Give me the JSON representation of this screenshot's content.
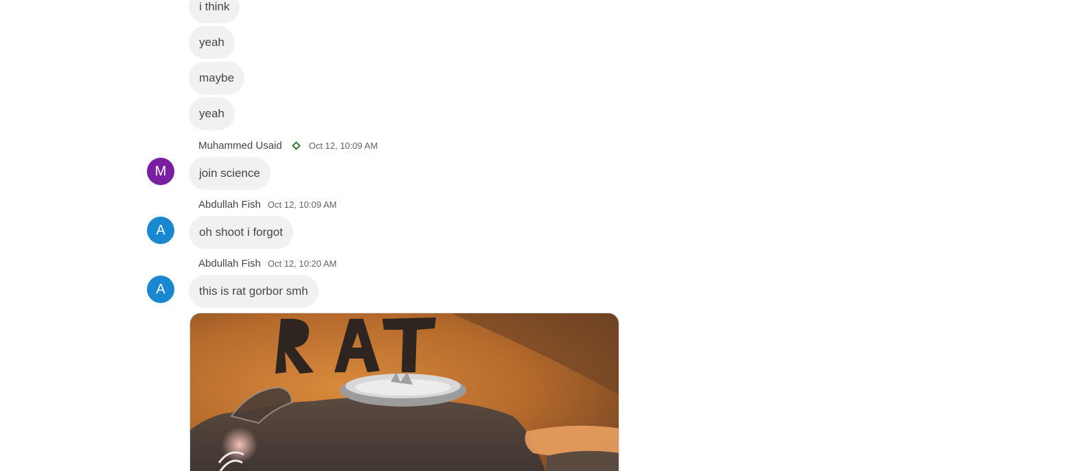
{
  "messages": {
    "m1": "i think",
    "m2": "yeah",
    "m3": "maybe",
    "m4": "yeah",
    "m5": "join science",
    "m6": "oh shoot i forgot",
    "m7": "this is rat gorbor smh"
  },
  "groups": {
    "g1": {
      "sender": "Muhammed Usaid",
      "time": "Oct 12, 10:09 AM",
      "avatar_letter": "M",
      "avatar_color": "#7b1fa2",
      "badge_icon": "diamond-badge-icon",
      "badge_color": "#2e7d32"
    },
    "g2": {
      "sender": "Abdullah Fish",
      "time": "Oct 12, 10:09 AM",
      "avatar_letter": "A",
      "avatar_color": "#1a88d1"
    },
    "g3": {
      "sender": "Abdullah Fish",
      "time": "Oct 12, 10:20 AM",
      "avatar_letter": "A",
      "avatar_color": "#1a88d1"
    }
  },
  "image": {
    "icon": "rat-drawing-image",
    "text_in_image": "RAT"
  },
  "colors": {
    "bubble_bg": "#f1f1f1",
    "bubble_text": "#444746",
    "meta_text": "#5f6368"
  }
}
